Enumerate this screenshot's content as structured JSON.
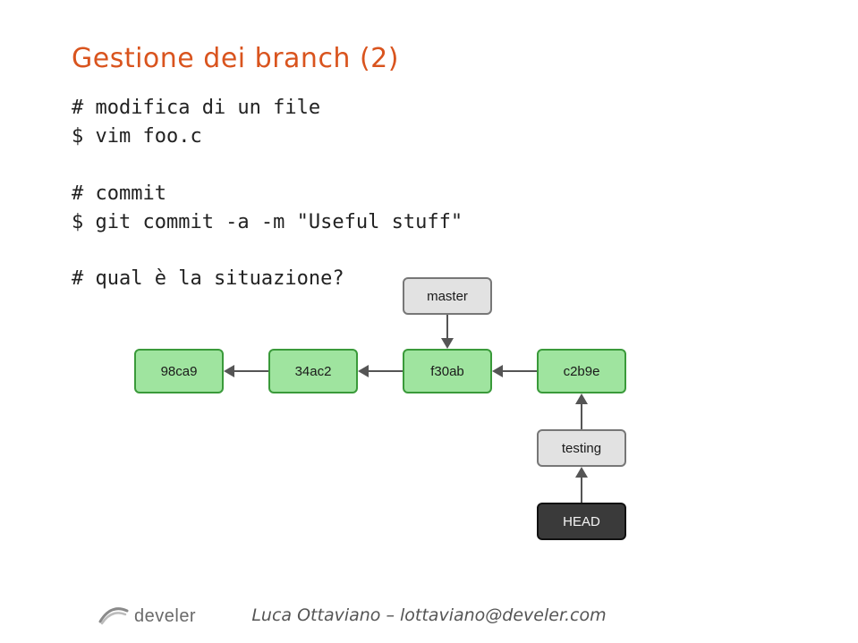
{
  "title": "Gestione dei branch (2)",
  "code": {
    "l1": "# modifica di un file",
    "l2": "$ vim foo.c",
    "l3": "",
    "l4": "# commit",
    "l5": "$ git commit -a -m \"Useful stuff\"",
    "l6": "",
    "l7": "# qual è la situazione?"
  },
  "diagram": {
    "commits": [
      "98ca9",
      "34ac2",
      "f30ab",
      "c2b9e"
    ],
    "branches": {
      "master": "master",
      "testing": "testing"
    },
    "head": "HEAD",
    "master_points_to": "f30ab",
    "testing_points_to": "c2b9e",
    "head_points_to": "testing"
  },
  "footer": "Luca Ottaviano – lottaviano@develer.com",
  "logo_text": "develer",
  "colors": {
    "accent": "#d9541e",
    "commit_fill": "#9fe49f",
    "commit_border": "#3a9a3a",
    "branch_fill": "#e2e2e2",
    "head_fill": "#3a3a3a"
  }
}
